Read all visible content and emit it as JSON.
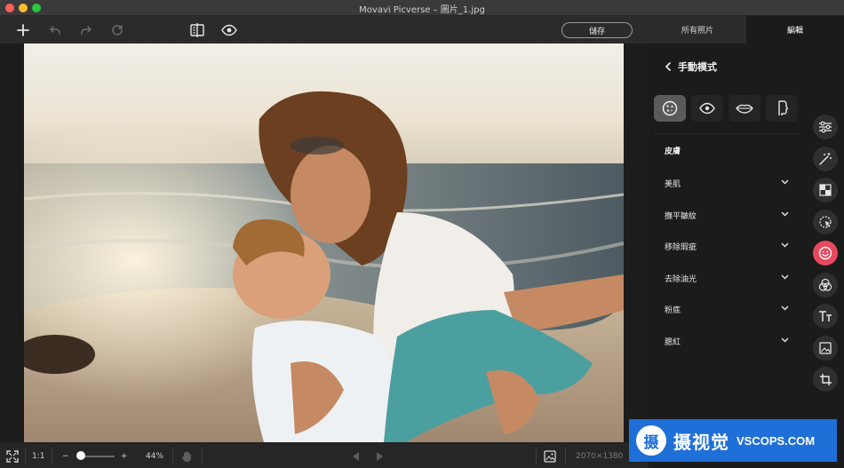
{
  "window": {
    "title": "Movavi Picverse – 圖片_1.jpg"
  },
  "toolbar": {
    "add_icon": "plus-icon",
    "undo_icon": "undo-icon",
    "redo_icon": "redo-icon",
    "reset_icon": "reset-icon",
    "compare_icon": "compare-icon",
    "preview_icon": "eye-icon",
    "save_label": "儲存",
    "tabs": [
      {
        "label": "所有照片",
        "active": false
      },
      {
        "label": "編輯",
        "active": true
      }
    ]
  },
  "canvas": {
    "image_description_name": "beach-photo"
  },
  "bottom_bar": {
    "fit_icon": "fit-screen-icon",
    "actual_size_label": "1:1",
    "zoom_minus": "−",
    "zoom_plus": "+",
    "zoom_level": "44%",
    "zoom_fraction": 0.1,
    "hand_icon": "hand-icon",
    "prev_icon": "prev-icon",
    "next_icon": "next-icon",
    "image_icon": "image-icon",
    "dimensions": "2070×1380"
  },
  "panel": {
    "back_icon": "chevron-left-icon",
    "header": "手動模式",
    "modes": [
      {
        "name": "skin-mode-icon",
        "active": true
      },
      {
        "name": "eye-mode-icon",
        "active": false
      },
      {
        "name": "lips-mode-icon",
        "active": false
      },
      {
        "name": "face-profile-mode-icon",
        "active": false
      }
    ],
    "section_title": "皮膚",
    "rows": [
      {
        "label": "美肌"
      },
      {
        "label": "撫平皺紋"
      },
      {
        "label": "移除瑕疵"
      },
      {
        "label": "去除油光"
      },
      {
        "label": "粉底"
      },
      {
        "label": "腮紅"
      }
    ]
  },
  "rail": {
    "tools": [
      {
        "name": "adjust-sliders-icon",
        "active": false
      },
      {
        "name": "magic-wand-icon",
        "active": false
      },
      {
        "name": "background-icon",
        "active": false
      },
      {
        "name": "object-select-icon",
        "active": false
      },
      {
        "name": "retouch-face-icon",
        "active": true
      },
      {
        "name": "color-circles-icon",
        "active": false
      },
      {
        "name": "text-icon",
        "active": false
      },
      {
        "name": "image-insert-icon",
        "active": false
      },
      {
        "name": "crop-icon",
        "active": false
      }
    ]
  },
  "watermark": {
    "brand": "摄视觉",
    "site": "VSCOPS.COM",
    "logo_char": "摄"
  },
  "colors": {
    "accent": "#e8485f",
    "panel_bg": "#1b1b1b",
    "watermark_bg": "#1f6fd8"
  }
}
